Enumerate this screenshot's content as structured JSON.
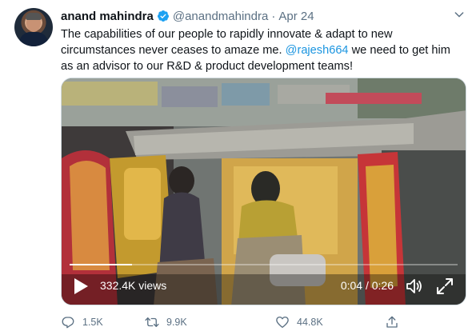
{
  "tweet": {
    "display_name": "anand mahindra",
    "handle": "@anandmahindra",
    "separator": "·",
    "date": "Apr 24",
    "text_before_mention": "The capabilities of our people to rapidly innovate & adapt to new circumstances never ceases to amaze me. ",
    "mention": "@rajesh664",
    "text_after_mention": " we need to get him as an advisor to our R&D & product development teams!"
  },
  "video": {
    "views": "332.4K views",
    "time": "0:04 / 0:26",
    "progress": 0.16
  },
  "actions": {
    "replies": "1.5K",
    "retweets": "9.9K",
    "likes": "44.8K"
  },
  "colors": {
    "link": "#1b95e0",
    "verified": "#1da1f2",
    "muted": "#5b7083"
  },
  "icons": [
    "verified-badge-icon",
    "chevron-down-icon",
    "play-icon",
    "volume-icon",
    "expand-icon",
    "reply-icon",
    "retweet-icon",
    "like-icon",
    "share-icon"
  ]
}
